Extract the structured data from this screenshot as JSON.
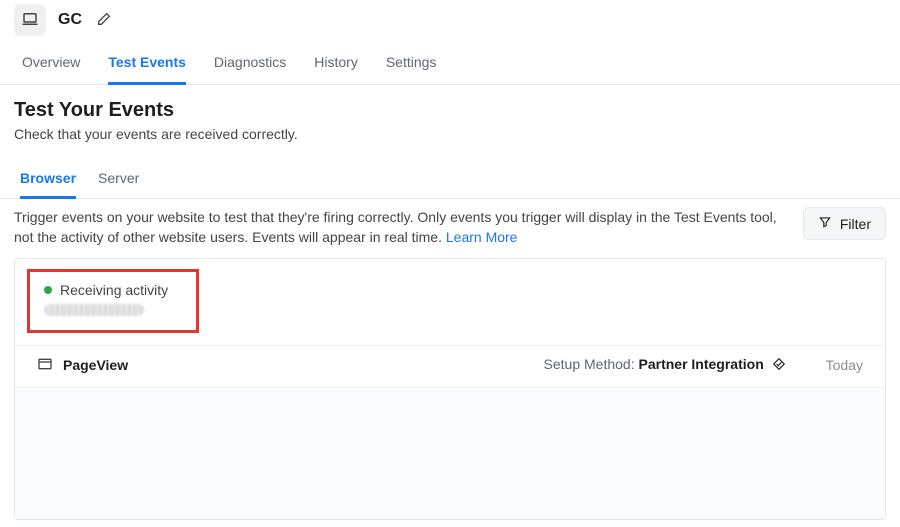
{
  "header": {
    "title": "GC"
  },
  "nav": {
    "tabs": [
      {
        "label": "Overview"
      },
      {
        "label": "Test Events",
        "active": true
      },
      {
        "label": "Diagnostics"
      },
      {
        "label": "History"
      },
      {
        "label": "Settings"
      }
    ]
  },
  "page": {
    "heading": "Test Your Events",
    "subtitle": "Check that your events are received correctly."
  },
  "subtabs": {
    "items": [
      {
        "label": "Browser",
        "active": true
      },
      {
        "label": "Server"
      }
    ]
  },
  "instructions": {
    "text": "Trigger events on your website to test that they're firing correctly. Only events you trigger will display in the Test Events tool, not the activity of other website users. Events will appear in real time. ",
    "learn_more": "Learn More"
  },
  "filter": {
    "label": "Filter"
  },
  "activity": {
    "status_label": "Receiving activity"
  },
  "events": {
    "rows": [
      {
        "name": "PageView",
        "setup_method_label": "Setup Method: ",
        "setup_method_value": "Partner Integration",
        "timestamp": "Today"
      }
    ]
  }
}
